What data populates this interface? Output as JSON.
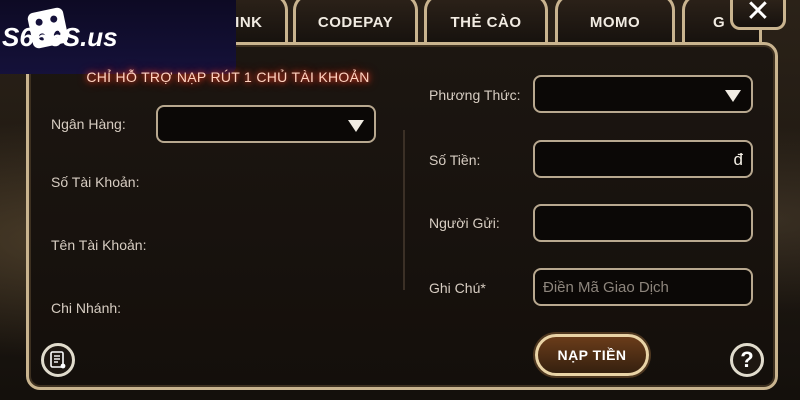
{
  "brand": {
    "logo_text": "S666S.us"
  },
  "tabs": [
    {
      "label": "LINK"
    },
    {
      "label": "CODEPAY"
    },
    {
      "label": "THẺ CÀO"
    },
    {
      "label": "MOMO"
    },
    {
      "label": "G"
    }
  ],
  "support_note": "CHỈ HỖ TRỢ NẠP RÚT 1 CHỦ TÀI KHOẢN",
  "left_form": {
    "bank_label": "Ngân Hàng:",
    "account_number_label": "Số Tài Khoản:",
    "account_name_label": "Tên Tài Khoản:",
    "branch_label": "Chi Nhánh:"
  },
  "right_form": {
    "method_label": "Phương Thức:",
    "amount_label": "Số Tiền:",
    "amount_currency": "đ",
    "sender_label": "Người Gửi:",
    "note_label": "Ghi Chú*",
    "note_placeholder": "Điền Mã Giao Dịch"
  },
  "actions": {
    "submit_label": "NẠP TIỀN",
    "help_label": "?",
    "close_label": "✕"
  }
}
